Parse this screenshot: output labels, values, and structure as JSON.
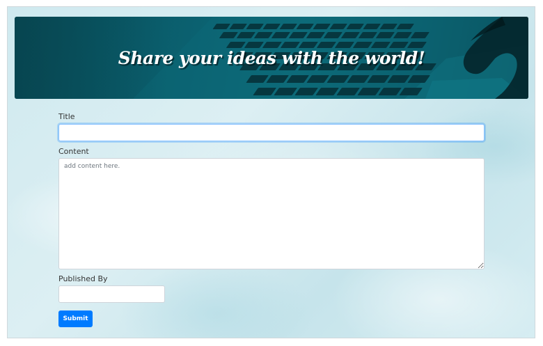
{
  "banner": {
    "title": "Share your ideas with the world!"
  },
  "form": {
    "title_label": "Title",
    "title_value": "",
    "content_label": "Content",
    "content_placeholder": "add content here.",
    "author_label": "Published By",
    "author_value": "",
    "submit_label": "Submit"
  },
  "colors": {
    "banner_overlay": "#0b6170",
    "submit_button": "#007bff",
    "focus_border": "#80bdff",
    "page_background": "#d3ecf1"
  }
}
